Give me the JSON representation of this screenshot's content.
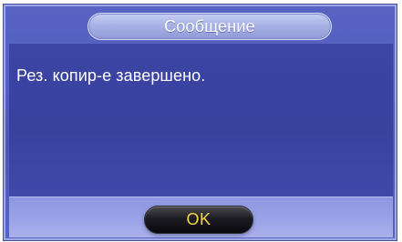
{
  "dialog": {
    "title": "Сообщение",
    "message": "Рез. копир-е завершено.",
    "ok_label": "OK"
  },
  "colors": {
    "frame_blue": "#5460bd",
    "panel_blue": "#3c44a4",
    "title_pill": "#a8b2e6",
    "footer_light": "#9aa3e7",
    "button_black": "#101014",
    "button_text": "#f3d54a"
  }
}
